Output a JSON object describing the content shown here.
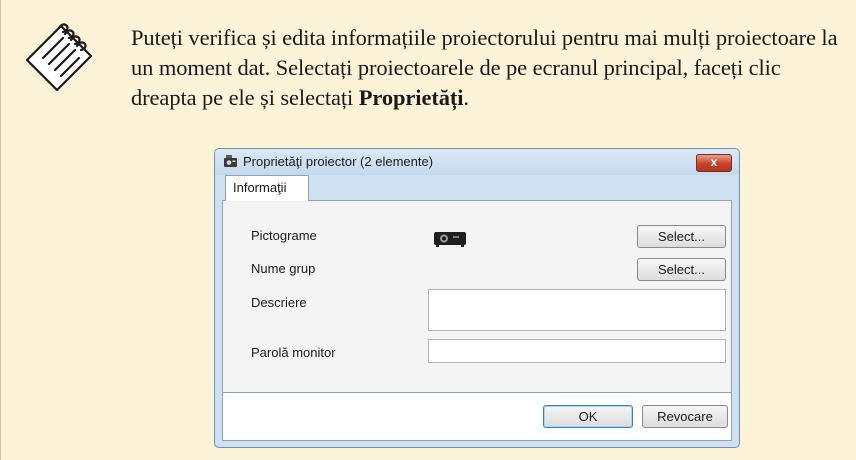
{
  "note": {
    "icon": "note-icon",
    "text_part1": "Puteți verifica și edita informațiile proiectorului pentru mai mulți proiectoare la un moment dat. Selectați proiectoarele de pe ecranul principal, faceți clic dreapta pe ele și selectați ",
    "text_bold": "Proprietăți",
    "text_end": "."
  },
  "dialog": {
    "title": "Proprietăţi proiector (2 elemente)",
    "title_icon": "projector-properties-icon",
    "close_icon": "close-icon",
    "close_label": "x",
    "tab_label": "Informaţii",
    "fields": {
      "icon_label": "Pictograme",
      "group_label": "Nume grup",
      "description_label": "Descriere",
      "password_label": "Parolă monitor",
      "icon_select_label": "Select...",
      "group_select_label": "Select...",
      "projector_icon": "projector-icon",
      "description_value": "",
      "password_value": ""
    },
    "ok_label": "OK",
    "cancel_label": "Revocare"
  },
  "colors": {
    "note_background": "#fdf3d8",
    "dialog_frame": "#cfe0f1",
    "close_button": "#c7432a"
  }
}
